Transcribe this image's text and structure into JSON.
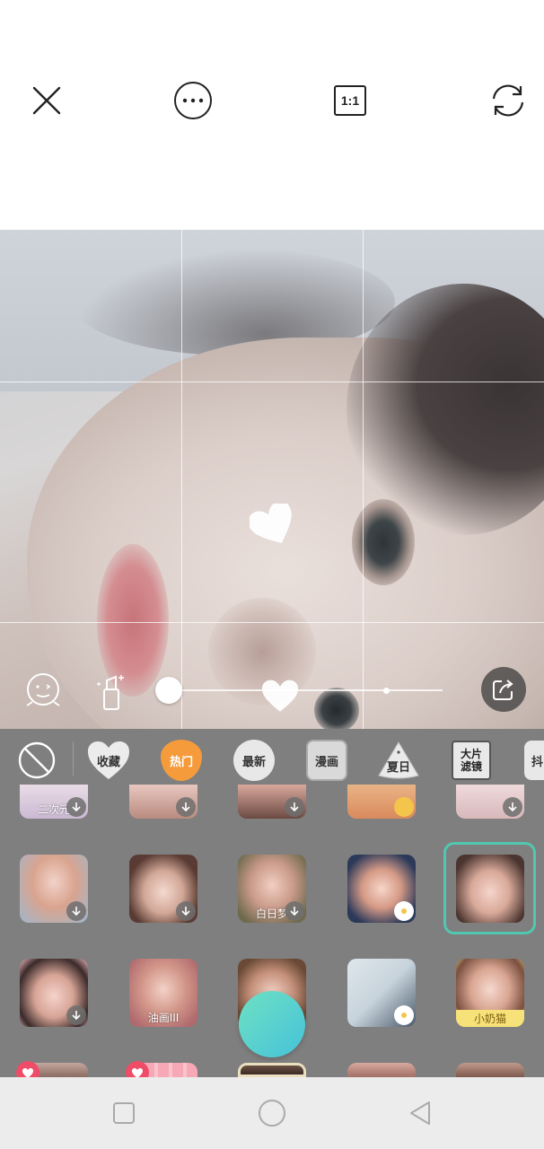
{
  "topbar": {
    "close_icon": "close-icon",
    "more_icon": "more-icon",
    "ratio_label": "1:1",
    "switch_icon": "switch-camera-icon"
  },
  "preview": {
    "grid": "3x3",
    "beauty_slider_value": 0.0,
    "left_controls": [
      "face-shape-icon",
      "makeup-icon"
    ],
    "share_icon": "share-icon"
  },
  "filter_tabs": [
    {
      "label": "",
      "icon": "none-icon"
    },
    {
      "label": "收藏",
      "icon": "heart-icon"
    },
    {
      "label": "热门",
      "icon": "flame-icon",
      "active": true
    },
    {
      "label": "最新",
      "icon": "circle-icon"
    },
    {
      "label": "漫画",
      "icon": "comic-icon"
    },
    {
      "label": "夏日",
      "icon": "watermelon-icon"
    },
    {
      "label": "大片滤镜",
      "line1": "大片",
      "line2": "滤镜",
      "icon": "film-icon"
    },
    {
      "label": "抖",
      "icon": "douyin-icon"
    }
  ],
  "stickers": {
    "row0": [
      {
        "label": "二次元"
      },
      {
        "label": ""
      },
      {
        "label": ""
      },
      {
        "label": ""
      },
      {
        "label": ""
      }
    ],
    "row1": [
      {
        "label": ""
      },
      {
        "label": ""
      },
      {
        "label": "白日梦"
      },
      {
        "label": ""
      },
      {
        "label": "",
        "selected": true
      }
    ],
    "row2": [
      {
        "label": ""
      },
      {
        "label": "油画III"
      },
      {
        "label": ""
      },
      {
        "label": ""
      },
      {
        "label": "小奶猫"
      }
    ]
  },
  "colors": {
    "accent": "#52c7b0",
    "active_tab": "#f59b3c",
    "shutter_start": "#6fe0c3",
    "shutter_end": "#45c3d9"
  },
  "navbar": [
    "square-icon",
    "circle-home-icon",
    "back-triangle-icon"
  ]
}
